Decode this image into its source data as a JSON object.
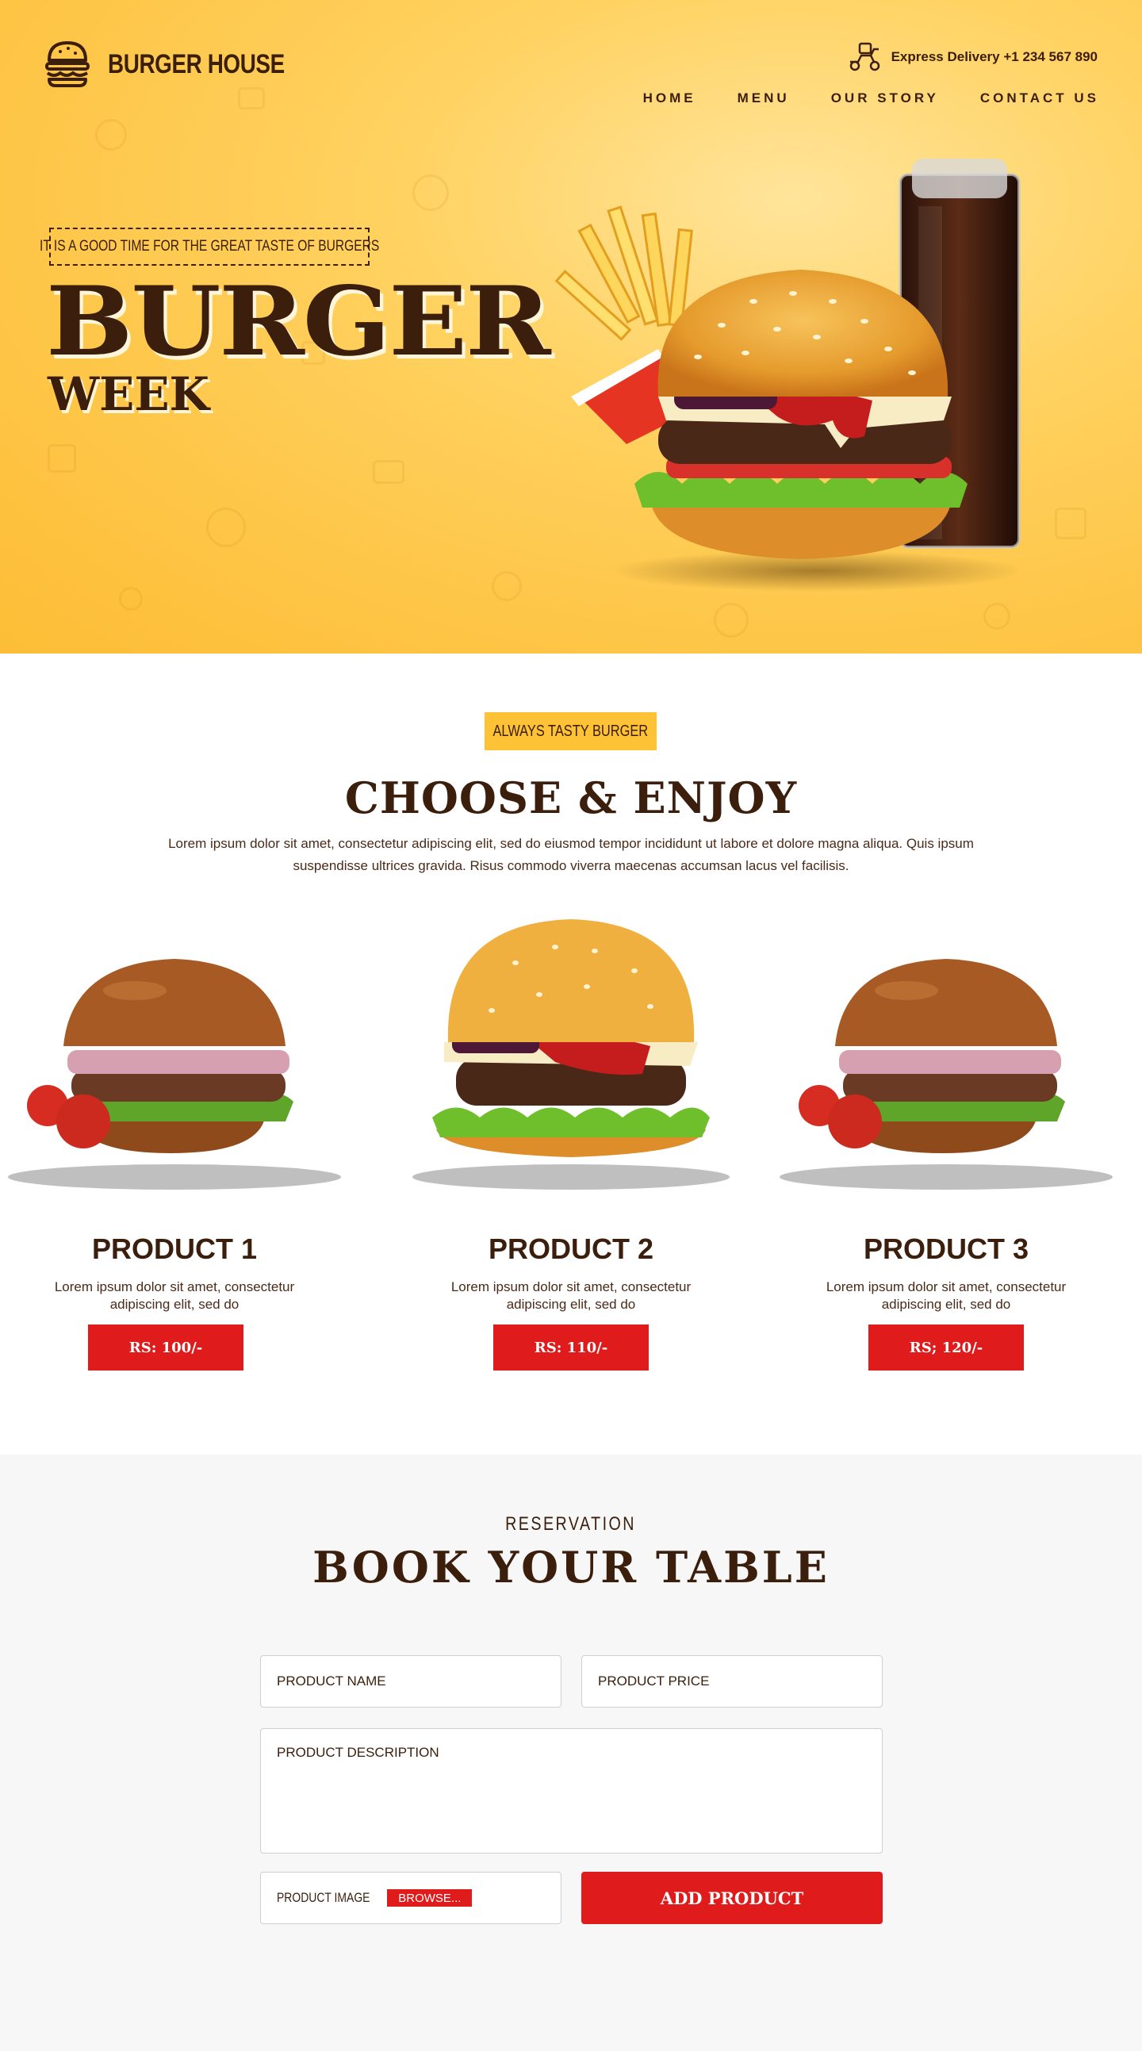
{
  "colors": {
    "accent_yellow": "#fec237",
    "brand_brown": "#3b1e0c",
    "cta_red": "#df1b1c",
    "section_gray": "#f7f7f7"
  },
  "header": {
    "brand_name": "BURGER HOUSE",
    "logo_icon": "burger-icon",
    "delivery_icon": "scooter-icon",
    "delivery_text": "Express Delivery +1 234 567 890",
    "nav": [
      "HOME",
      "MENU",
      "OUR STORY",
      "CONTACT US"
    ]
  },
  "hero": {
    "tagline": "IT IS A GOOD TIME FOR THE GREAT TASTE OF BURGERS",
    "title": "BURGER",
    "subtitle": "WEEK"
  },
  "choose": {
    "badge": "ALWAYS TASTY BURGER",
    "title": "CHOOSE & ENJOY",
    "intro": "Lorem ipsum dolor sit amet, consectetur adipiscing elit, sed do eiusmod tempor incididunt ut labore et dolore magna aliqua. Quis ipsum suspendisse ultrices gravida. Risus commodo viverra maecenas accumsan lacus vel facilisis.",
    "products": [
      {
        "name": "PRODUCT 1",
        "desc_line1": "Lorem ipsum dolor sit amet, consectetur",
        "desc_line2": "adipiscing elit, sed do",
        "price": "RS: 100/-"
      },
      {
        "name": "PRODUCT 2",
        "desc_line1": "Lorem ipsum dolor sit amet, consectetur",
        "desc_line2": "adipiscing elit, sed do",
        "price": "RS: 110/-"
      },
      {
        "name": "PRODUCT 3",
        "desc_line1": "Lorem ipsum dolor sit amet, consectetur",
        "desc_line2": "adipiscing elit, sed do",
        "price": "RS; 120/-"
      }
    ]
  },
  "reservation": {
    "kicker": "RESERVATION",
    "title": "BOOK YOUR TABLE",
    "product_name_placeholder": "PRODUCT NAME",
    "product_price_placeholder": "PRODUCT PRICE",
    "product_description_placeholder": "PRODUCT DESCRIPTION",
    "product_image_label": "PRODUCT IMAGE",
    "browse_label": "BROWSE...",
    "submit_label": "ADD PRODUCT"
  }
}
